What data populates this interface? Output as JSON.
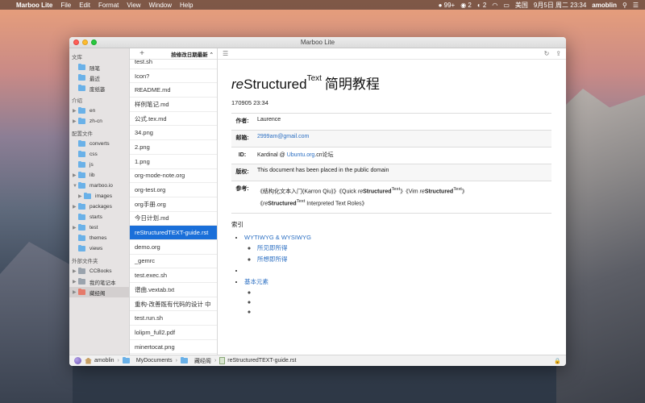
{
  "menubar": {
    "app_name": "Marboo Lite",
    "menus": [
      "File",
      "Edit",
      "Format",
      "View",
      "Window",
      "Help"
    ],
    "status_items": [
      "99+",
      "2",
      "2"
    ],
    "input_source": "美国",
    "datetime": "9月5日 周二  23:34",
    "user": "amoblin"
  },
  "window": {
    "title": "Marboo Lite"
  },
  "sidebar": {
    "sections": [
      {
        "label": "文库",
        "items": [
          {
            "label": "随笔",
            "arrow": ""
          },
          {
            "label": "最近",
            "arrow": ""
          },
          {
            "label": "废纸篓",
            "arrow": ""
          }
        ]
      },
      {
        "label": "介绍",
        "items": [
          {
            "label": "en",
            "arrow": "▶"
          },
          {
            "label": "zh-cn",
            "arrow": "▶"
          }
        ]
      },
      {
        "label": "配置文件",
        "items": [
          {
            "label": "converts",
            "arrow": ""
          },
          {
            "label": "css",
            "arrow": ""
          },
          {
            "label": "js",
            "arrow": ""
          },
          {
            "label": "lib",
            "arrow": "▶"
          },
          {
            "label": "marboo.io",
            "arrow": "▼"
          },
          {
            "label": "images",
            "arrow": "▶"
          },
          {
            "label": "packages",
            "arrow": "▶"
          },
          {
            "label": "starts",
            "arrow": ""
          },
          {
            "label": "test",
            "arrow": "▶"
          },
          {
            "label": "themes",
            "arrow": ""
          },
          {
            "label": "views",
            "arrow": ""
          }
        ]
      },
      {
        "label": "外部文件夹",
        "items": [
          {
            "label": "CCBooks",
            "arrow": "▶"
          },
          {
            "label": "我的笔记本",
            "arrow": "▶"
          },
          {
            "label": "藏经阁",
            "arrow": "▶"
          }
        ]
      }
    ]
  },
  "filelist": {
    "add_label": "+",
    "sort_label": "按修改日期最新 ⌃",
    "items": [
      "test.sh",
      "Icon?",
      "README.md",
      "样例笔记.md",
      "公式.tex.md",
      "34.png",
      "2.png",
      "1.png",
      "org-mode-note.org",
      "org-test.org",
      "org手册.org",
      "今日计划.md",
      "reStructuredTEXT-guide.rst",
      "demo.org",
      "_gemrc",
      "test.exec.sh",
      "谱曲.vextab.txt",
      "重构-改善既有代码的设计 中",
      "test.run.sh",
      "lolipm_full2.pdf",
      "minertocat.png"
    ]
  },
  "doc": {
    "title_re": "re",
    "title_structured": "Structured",
    "title_sup": "Text",
    "title_rest": "简明教程",
    "date": "170905 23:34",
    "rows": [
      {
        "key": "作者:",
        "value": "Laurence"
      },
      {
        "key": "邮箱:",
        "value": "2999am@gmail.com"
      },
      {
        "key": "ID:",
        "value_pre": "Kardinal @ ",
        "value_link": "Ubuntu.org",
        "value_post": ".cn论坛"
      },
      {
        "key": "版权:",
        "value": "This document has been placed in the public domain"
      },
      {
        "key": "参考:",
        "ref1": "《结构化文本入门(Karron Qiu)》《Quick ",
        "ref_re": "re",
        "ref_structured": "Structured",
        "ref_sup": "Text",
        "ref2": "》《Vim ",
        "ref3": "》",
        "ref4": "《",
        "ref5": " Interpreted Text Roles》"
      }
    ],
    "section_title": "索引",
    "toc": {
      "item1": "WYTIWYG & WYSIWYG",
      "item1_sub": [
        "所见即所得",
        "所想即所得"
      ],
      "item3": "基本元素"
    }
  },
  "statusbar": {
    "crumbs": [
      "amoblin",
      "MyDocuments",
      "藏经阁",
      "reStructuredTEXT-guide.rst"
    ]
  },
  "colors": {
    "accent": "#1a6fd9",
    "link": "#2a6ec2"
  }
}
